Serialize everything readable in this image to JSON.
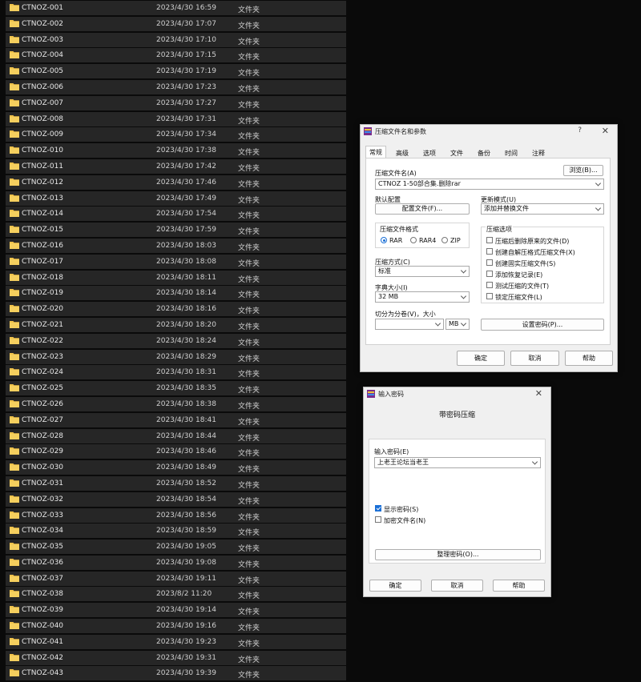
{
  "colors": {
    "folder": "#f0c24a",
    "accent": "#1a6fd6",
    "row_bg": "#262626"
  },
  "files": [
    {
      "name": "CTNOZ-001",
      "date": "2023/4/30 16:59",
      "type": "文件夹"
    },
    {
      "name": "CTNOZ-002",
      "date": "2023/4/30 17:07",
      "type": "文件夹"
    },
    {
      "name": "CTNOZ-003",
      "date": "2023/4/30 17:10",
      "type": "文件夹"
    },
    {
      "name": "CTNOZ-004",
      "date": "2023/4/30 17:15",
      "type": "文件夹"
    },
    {
      "name": "CTNOZ-005",
      "date": "2023/4/30 17:19",
      "type": "文件夹"
    },
    {
      "name": "CTNOZ-006",
      "date": "2023/4/30 17:23",
      "type": "文件夹"
    },
    {
      "name": "CTNOZ-007",
      "date": "2023/4/30 17:27",
      "type": "文件夹"
    },
    {
      "name": "CTNOZ-008",
      "date": "2023/4/30 17:31",
      "type": "文件夹"
    },
    {
      "name": "CTNOZ-009",
      "date": "2023/4/30 17:34",
      "type": "文件夹"
    },
    {
      "name": "CTNOZ-010",
      "date": "2023/4/30 17:38",
      "type": "文件夹"
    },
    {
      "name": "CTNOZ-011",
      "date": "2023/4/30 17:42",
      "type": "文件夹"
    },
    {
      "name": "CTNOZ-012",
      "date": "2023/4/30 17:46",
      "type": "文件夹"
    },
    {
      "name": "CTNOZ-013",
      "date": "2023/4/30 17:49",
      "type": "文件夹"
    },
    {
      "name": "CTNOZ-014",
      "date": "2023/4/30 17:54",
      "type": "文件夹"
    },
    {
      "name": "CTNOZ-015",
      "date": "2023/4/30 17:59",
      "type": "文件夹"
    },
    {
      "name": "CTNOZ-016",
      "date": "2023/4/30 18:03",
      "type": "文件夹"
    },
    {
      "name": "CTNOZ-017",
      "date": "2023/4/30 18:08",
      "type": "文件夹"
    },
    {
      "name": "CTNOZ-018",
      "date": "2023/4/30 18:11",
      "type": "文件夹"
    },
    {
      "name": "CTNOZ-019",
      "date": "2023/4/30 18:14",
      "type": "文件夹"
    },
    {
      "name": "CTNOZ-020",
      "date": "2023/4/30 18:16",
      "type": "文件夹"
    },
    {
      "name": "CTNOZ-021",
      "date": "2023/4/30 18:20",
      "type": "文件夹"
    },
    {
      "name": "CTNOZ-022",
      "date": "2023/4/30 18:24",
      "type": "文件夹"
    },
    {
      "name": "CTNOZ-023",
      "date": "2023/4/30 18:29",
      "type": "文件夹"
    },
    {
      "name": "CTNOZ-024",
      "date": "2023/4/30 18:31",
      "type": "文件夹"
    },
    {
      "name": "CTNOZ-025",
      "date": "2023/4/30 18:35",
      "type": "文件夹"
    },
    {
      "name": "CTNOZ-026",
      "date": "2023/4/30 18:38",
      "type": "文件夹"
    },
    {
      "name": "CTNOZ-027",
      "date": "2023/4/30 18:41",
      "type": "文件夹"
    },
    {
      "name": "CTNOZ-028",
      "date": "2023/4/30 18:44",
      "type": "文件夹"
    },
    {
      "name": "CTNOZ-029",
      "date": "2023/4/30 18:46",
      "type": "文件夹"
    },
    {
      "name": "CTNOZ-030",
      "date": "2023/4/30 18:49",
      "type": "文件夹"
    },
    {
      "name": "CTNOZ-031",
      "date": "2023/4/30 18:52",
      "type": "文件夹"
    },
    {
      "name": "CTNOZ-032",
      "date": "2023/4/30 18:54",
      "type": "文件夹"
    },
    {
      "name": "CTNOZ-033",
      "date": "2023/4/30 18:56",
      "type": "文件夹"
    },
    {
      "name": "CTNOZ-034",
      "date": "2023/4/30 18:59",
      "type": "文件夹"
    },
    {
      "name": "CTNOZ-035",
      "date": "2023/4/30 19:05",
      "type": "文件夹"
    },
    {
      "name": "CTNOZ-036",
      "date": "2023/4/30 19:08",
      "type": "文件夹"
    },
    {
      "name": "CTNOZ-037",
      "date": "2023/4/30 19:11",
      "type": "文件夹"
    },
    {
      "name": "CTNOZ-038",
      "date": "2023/8/2 11:20",
      "type": "文件夹"
    },
    {
      "name": "CTNOZ-039",
      "date": "2023/4/30 19:14",
      "type": "文件夹"
    },
    {
      "name": "CTNOZ-040",
      "date": "2023/4/30 19:16",
      "type": "文件夹"
    },
    {
      "name": "CTNOZ-041",
      "date": "2023/4/30 19:23",
      "type": "文件夹"
    },
    {
      "name": "CTNOZ-042",
      "date": "2023/4/30 19:31",
      "type": "文件夹"
    },
    {
      "name": "CTNOZ-043",
      "date": "2023/4/30 19:39",
      "type": "文件夹"
    }
  ],
  "archive_dialog": {
    "title": "压缩文件名和参数",
    "help_q": "?",
    "close": "✕",
    "tabs": [
      "常规",
      "高级",
      "选项",
      "文件",
      "备份",
      "时间",
      "注释"
    ],
    "archive_name_label": "压缩文件名(A)",
    "browse": "浏览(B)...",
    "archive_name_value": "CTNOZ 1-50部合集.删除rar",
    "profile_label": "默认配置",
    "profile_button": "配置文件(F)...",
    "update_mode_label": "更新模式(U)",
    "update_mode_value": "添加并替换文件",
    "format_group": "压缩文件格式",
    "formats": [
      "RAR",
      "RAR4",
      "ZIP"
    ],
    "method_label": "压缩方式(C)",
    "method_value": "标准",
    "dict_label": "字典大小(I)",
    "dict_value": "32 MB",
    "split_label": "切分为分卷(V)，大小",
    "split_unit": "MB",
    "options_group": "压缩选项",
    "options": [
      "压缩后删除原来的文件(D)",
      "创建自解压格式压缩文件(X)",
      "创建固实压缩文件(S)",
      "添加恢复记录(E)",
      "测试压缩的文件(T)",
      "锁定压缩文件(L)"
    ],
    "set_password": "设置密码(P)...",
    "ok": "确定",
    "cancel": "取消",
    "help": "帮助"
  },
  "password_dialog": {
    "title": "输入密码",
    "close": "✕",
    "heading": "带密码压缩",
    "enter_label": "输入密码(E)",
    "password_value": "上老王论坛当老王",
    "show_password": "显示密码(S)",
    "encrypt_names": "加密文件名(N)",
    "organize": "整理密码(O)...",
    "ok": "确定",
    "cancel": "取消",
    "help": "帮助"
  }
}
